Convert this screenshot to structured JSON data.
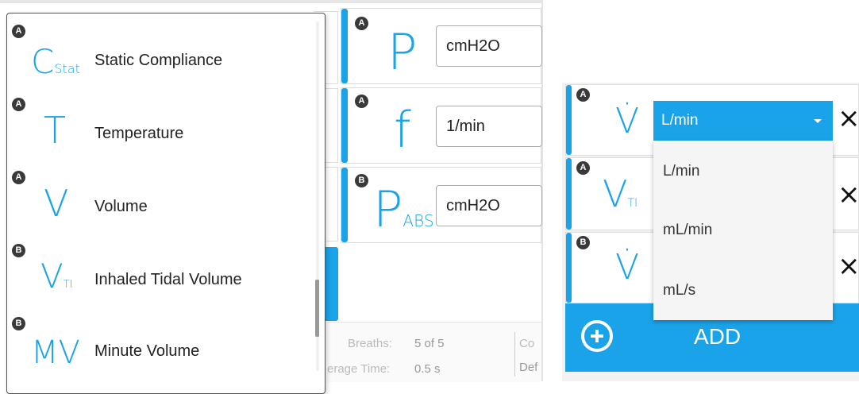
{
  "left_panel": {
    "cards": [
      {
        "badge": "A",
        "symbol": "P",
        "unit": "cmH2O"
      },
      {
        "badge": "A",
        "symbol": "f",
        "unit": "1/min"
      },
      {
        "badge": "B",
        "symbol": "P",
        "subscript": "ABS",
        "unit": "cmH2O"
      }
    ],
    "footer": {
      "breaths_label": "Breaths:",
      "breaths_value": "5 of 5",
      "avg_time_label": "erage Time:",
      "avg_time_value": "0.5 s",
      "right_text_1": "Co",
      "right_text_2": "Def"
    }
  },
  "parameter_list": {
    "items": [
      {
        "badge": "A",
        "symbol": "C",
        "subscript": "Stat",
        "label": "Static Compliance"
      },
      {
        "badge": "A",
        "symbol": "T",
        "subscript": "",
        "label": "Temperature"
      },
      {
        "badge": "A",
        "symbol": "V",
        "subscript": "",
        "label": "Volume"
      },
      {
        "badge": "B",
        "symbol": "V",
        "subscript": "TI",
        "label": "Inhaled Tidal Volume"
      },
      {
        "badge": "B",
        "symbol": "MV",
        "subscript": "",
        "label": "Minute Volume"
      }
    ]
  },
  "right_panel": {
    "rows": [
      {
        "badge": "A",
        "symbol": "V̇"
      },
      {
        "badge": "A",
        "symbol": "V",
        "subscript": "TI"
      },
      {
        "badge": "B",
        "symbol": "V̇"
      }
    ],
    "dropdown": {
      "selected": "L/min",
      "options": [
        "L/min",
        "mL/min",
        "mL/s"
      ]
    },
    "add_button": {
      "label": "ADD"
    },
    "close_glyph": "×"
  },
  "colors": {
    "accent": "#1aa3e8",
    "badge": "#3a3a3a"
  }
}
